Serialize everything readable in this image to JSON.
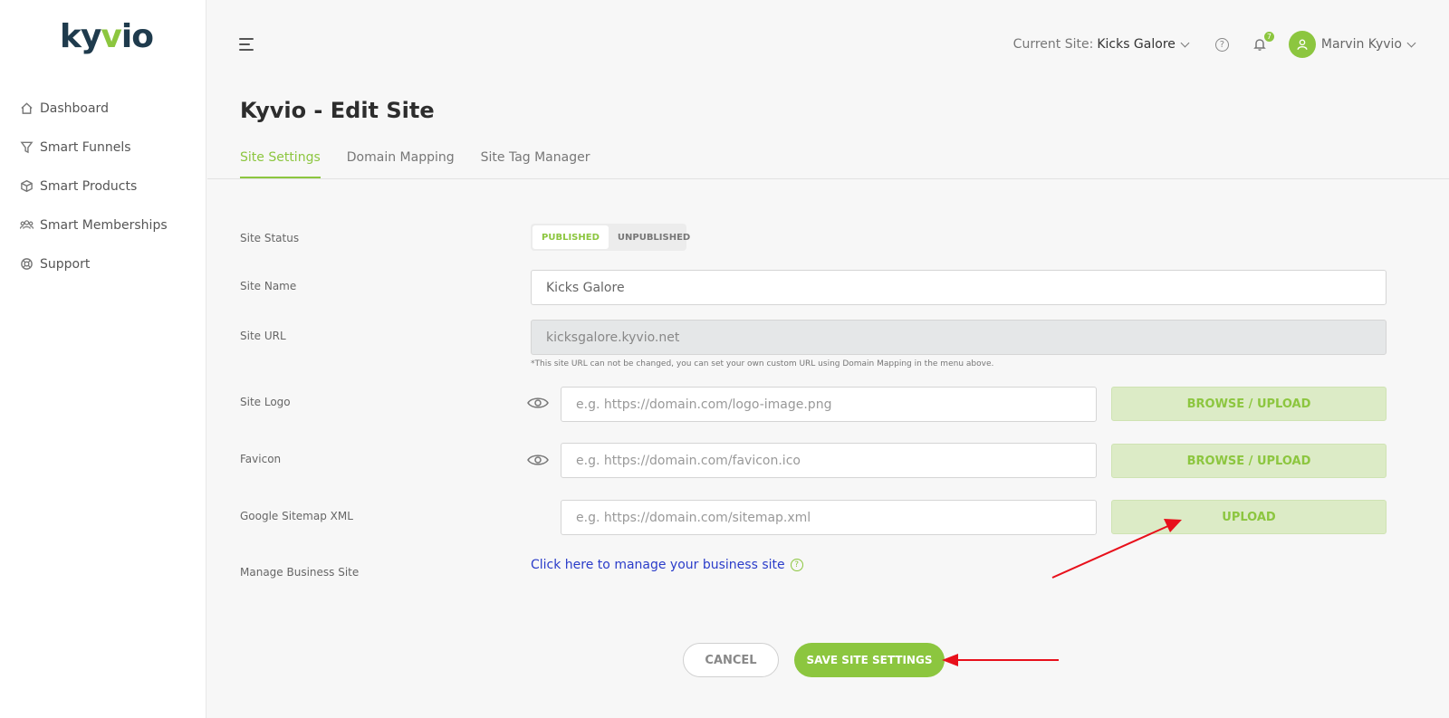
{
  "app": {
    "logo_text_a": "ky",
    "logo_text_b": "v",
    "logo_text_c": "io"
  },
  "sidebar": {
    "items": [
      {
        "label": "Dashboard",
        "icon": "home-icon"
      },
      {
        "label": "Smart Funnels",
        "icon": "funnel-icon"
      },
      {
        "label": "Smart Products",
        "icon": "box-icon"
      },
      {
        "label": "Smart Memberships",
        "icon": "users-icon"
      },
      {
        "label": "Support",
        "icon": "lifebuoy-icon"
      }
    ]
  },
  "topbar": {
    "current_site_label": "Current Site:",
    "current_site_value": "Kicks Galore",
    "notification_count": "7",
    "user_name": "Marvin Kyvio"
  },
  "page": {
    "title": "Kyvio - Edit Site",
    "tabs": [
      "Site Settings",
      "Domain Mapping",
      "Site Tag Manager"
    ]
  },
  "form": {
    "site_status_label": "Site Status",
    "status_published": "PUBLISHED",
    "status_unpublished": "UNPUBLISHED",
    "site_name_label": "Site Name",
    "site_name_value": "Kicks Galore",
    "site_url_label": "Site URL",
    "site_url_value": "kicksgalore.kyvio.net",
    "site_url_hint": "*This site URL can not be changed, you can set your own custom URL using Domain Mapping in the menu above.",
    "site_logo_label": "Site Logo",
    "site_logo_placeholder": "e.g. https://domain.com/logo-image.png",
    "favicon_label": "Favicon",
    "favicon_placeholder": "e.g. https://domain.com/favicon.ico",
    "sitemap_label": "Google Sitemap XML",
    "sitemap_placeholder": "e.g. https://domain.com/sitemap.xml",
    "browse_upload": "BROWSE / UPLOAD",
    "upload": "UPLOAD",
    "manage_label": "Manage Business Site",
    "manage_link": "Click here to manage your business site"
  },
  "actions": {
    "cancel": "CANCEL",
    "save": "SAVE SITE SETTINGS"
  },
  "colors": {
    "accent": "#8cc63f",
    "brand_dark": "#1f3b4d",
    "link": "#2a3cc9",
    "annotation": "#e8101b"
  }
}
